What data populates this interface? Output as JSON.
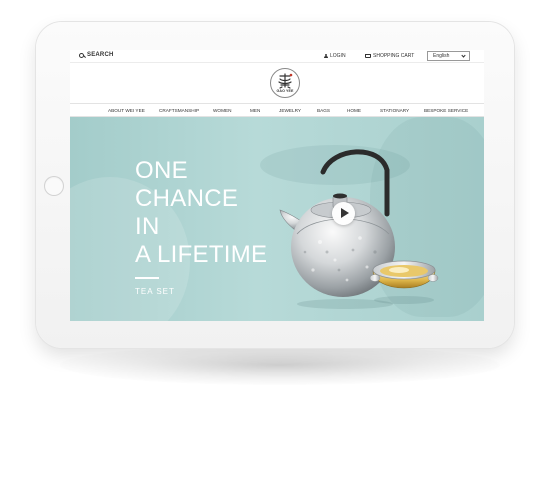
{
  "header": {
    "search_label": "SEARCH",
    "login_label": "LOGIN",
    "cart_label": "SHOPPING CART",
    "language": "English"
  },
  "logo": {
    "text": "GAO YEE"
  },
  "nav": {
    "items": [
      "ABOUT WEI YEE",
      "CRAFTSMANSHIP",
      "WOMEN",
      "MEN",
      "JEWELRY",
      "BAGS",
      "HOME",
      "STATIONARY",
      "BESPOKE SERVICE"
    ]
  },
  "hero": {
    "title_lines": [
      "ONE",
      "CHANCE",
      "IN",
      "A LIFETIME"
    ],
    "subtitle": "TEA SET"
  },
  "icons": {
    "search": "search-icon",
    "login": "user-icon",
    "cart": "cart-icon",
    "language_dropdown": "chevron-down-icon",
    "play": "play-icon"
  },
  "colors": {
    "hero_background": "#a9d0ce",
    "hero_text": "#ffffff",
    "text": "#333333"
  }
}
